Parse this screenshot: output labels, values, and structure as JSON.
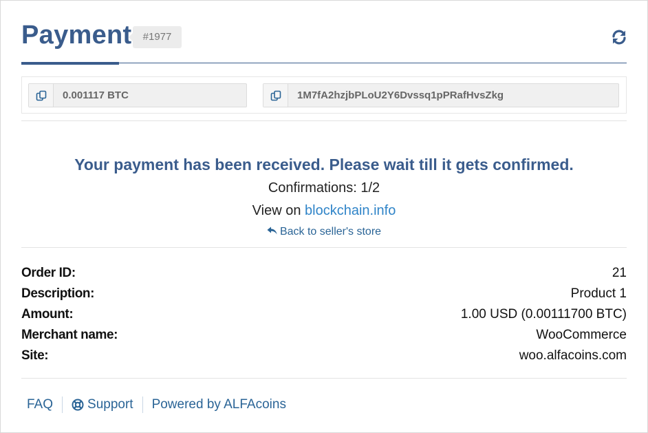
{
  "header": {
    "title": "Payment",
    "order_number": "#1977",
    "refresh_icon": "refresh-icon"
  },
  "copy_fields": {
    "amount": "0.001117 BTC",
    "address": "1M7fA2hzjbPLoU2Y6Dvssq1pPRafHvsZkg",
    "copy_icon": "copy-icon"
  },
  "status": {
    "message": "Your payment has been received. Please wait till it gets confirmed.",
    "confirmations": "Confirmations: 1/2",
    "view_prefix": "View on",
    "view_link": "blockchain.info",
    "back_link": "Back to seller's store",
    "back_icon": "reply-arrow-icon"
  },
  "details": [
    {
      "label": "Order ID:",
      "value": "21"
    },
    {
      "label": "Description:",
      "value": "Product 1"
    },
    {
      "label": "Amount:",
      "value": "1.00 USD (0.00111700 BTC)"
    },
    {
      "label": "Merchant name:",
      "value": "WooCommerce"
    },
    {
      "label": "Site:",
      "value": "woo.alfacoins.com"
    }
  ],
  "footer": {
    "faq": "FAQ",
    "support": "Support",
    "support_icon": "lifebuoy-icon",
    "powered": "Powered by ALFAcoins"
  },
  "colors": {
    "accent": "#3a5c8c",
    "link": "#2a6496"
  }
}
